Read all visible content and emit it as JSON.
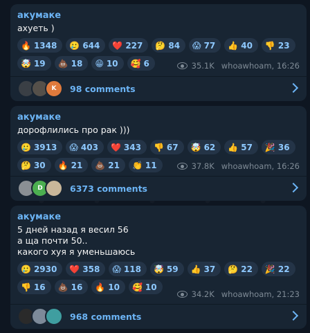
{
  "posts": [
    {
      "author": "акумаке",
      "text": "ахуеть )",
      "reactions": [
        {
          "emoji": "🔥",
          "count": "1348"
        },
        {
          "emoji": "🥲",
          "count": "644"
        },
        {
          "emoji": "❤️",
          "count": "227"
        },
        {
          "emoji": "🤔",
          "count": "84"
        },
        {
          "emoji": "😱",
          "count": "77"
        },
        {
          "emoji": "👍",
          "count": "40"
        },
        {
          "emoji": "👎",
          "count": "23"
        },
        {
          "emoji": "🤯",
          "count": "19"
        },
        {
          "emoji": "💩",
          "count": "18"
        },
        {
          "emoji": "😁",
          "count": "10"
        },
        {
          "emoji": "🥰",
          "count": "6"
        }
      ],
      "views": "35.1K",
      "signature": "whoawhoam, 16:26",
      "comments": "98 comments",
      "avatars": [
        {
          "letter": "",
          "color": "#3a3f45"
        },
        {
          "letter": "",
          "color": "#55504a"
        },
        {
          "letter": "K",
          "color": "#e07a3c"
        }
      ]
    },
    {
      "author": "акумаке",
      "text": "дорофлились про рак )))",
      "reactions": [
        {
          "emoji": "🥲",
          "count": "3913"
        },
        {
          "emoji": "😱",
          "count": "403"
        },
        {
          "emoji": "❤️",
          "count": "343"
        },
        {
          "emoji": "👎",
          "count": "67"
        },
        {
          "emoji": "🤯",
          "count": "62"
        },
        {
          "emoji": "👍",
          "count": "57"
        },
        {
          "emoji": "🎉",
          "count": "36"
        },
        {
          "emoji": "🤔",
          "count": "30"
        },
        {
          "emoji": "🔥",
          "count": "21"
        },
        {
          "emoji": "💩",
          "count": "21"
        },
        {
          "emoji": "👏",
          "count": "11"
        }
      ],
      "views": "37.8K",
      "signature": "whoawhoam, 16:26",
      "comments": "6373 comments",
      "avatars": [
        {
          "letter": "",
          "color": "#8a8f94"
        },
        {
          "letter": "D",
          "color": "#4caf50"
        },
        {
          "letter": "",
          "color": "#c9b79a"
        }
      ]
    },
    {
      "author": "акумаке",
      "text": "5 дней назад я весил 56\nа ща почти 50..\nкакого хуя я уменьшаюсь",
      "reactions": [
        {
          "emoji": "🥲",
          "count": "2930"
        },
        {
          "emoji": "❤️",
          "count": "358"
        },
        {
          "emoji": "😱",
          "count": "118"
        },
        {
          "emoji": "🤯",
          "count": "59"
        },
        {
          "emoji": "👍",
          "count": "37"
        },
        {
          "emoji": "🤔",
          "count": "22"
        },
        {
          "emoji": "🎉",
          "count": "22"
        },
        {
          "emoji": "👎",
          "count": "16"
        },
        {
          "emoji": "💩",
          "count": "16"
        },
        {
          "emoji": "🔥",
          "count": "10"
        },
        {
          "emoji": "🥰",
          "count": "10"
        }
      ],
      "views": "34.2K",
      "signature": "whoawhoam, 21:23",
      "comments": "968 comments",
      "avatars": [
        {
          "letter": "",
          "color": "#2a2a2a"
        },
        {
          "letter": "",
          "color": "#7d8a99"
        },
        {
          "letter": "",
          "color": "#3f9ea0"
        }
      ]
    }
  ]
}
